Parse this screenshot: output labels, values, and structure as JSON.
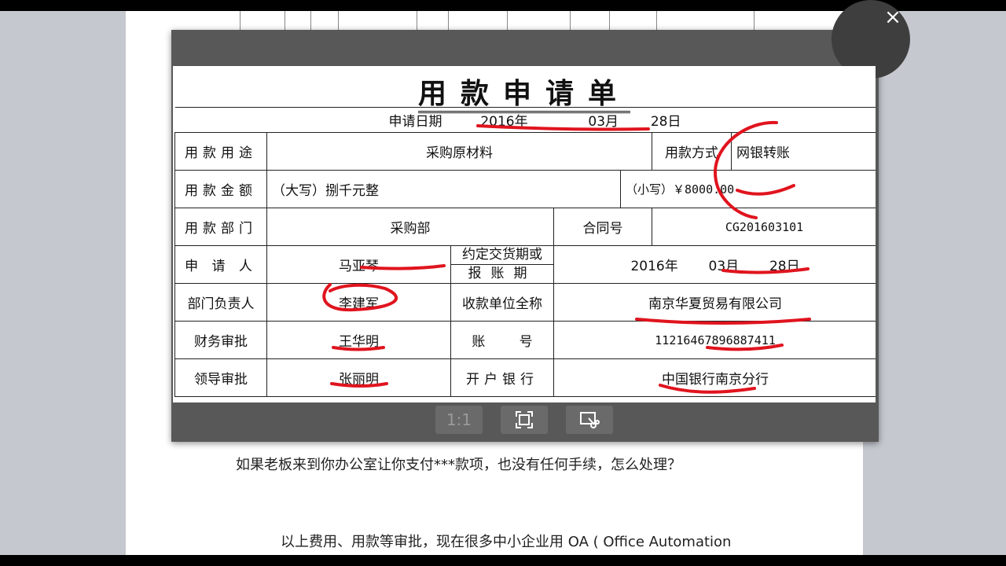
{
  "document": {
    "line1": "如果老板来到你办公室让你支付***款项，也没有任何手续，怎么处理？",
    "line2": "以上费用、用款等审批，现在很多中小企业用 OA ( Office Automation"
  },
  "viewer": {
    "close_label": "×",
    "close_icon": "close-icon",
    "toolbar": {
      "actual_size_label": "1:1",
      "fit_icon": "fit-screen-icon",
      "crop_icon": "screenshot-scissors-icon"
    }
  },
  "form": {
    "title": "用款申请单",
    "apply_date_label": "申请日期",
    "apply_date_year": "2016年",
    "apply_date_month": "03月",
    "apply_date_day": "28日",
    "purpose_label": "用款用途",
    "purpose_value": "采购原材料",
    "method_label": "用款方式",
    "method_value": "网银转账",
    "amount_label": "用款金额",
    "amount_upper": "（大写）捌千元整",
    "amount_lower": "（小写）￥8000.00",
    "dept_label": "用款部门",
    "dept_value": "采购部",
    "contract_label": "合同号",
    "contract_value": "CG201603101",
    "applicant_label": "申 请 人",
    "applicant_value": "马亚琴",
    "delivery_label_top": "约定交货期或",
    "delivery_label_bottom": "报账期",
    "delivery_year": "2016年",
    "delivery_month": "03月",
    "delivery_day": "28日",
    "dept_head_label": "部门负责人",
    "dept_head_value": "李建军",
    "payee_label": "收款单位全称",
    "payee_value": "南京华夏贸易有限公司",
    "finance_label": "财务审批",
    "finance_value": "王华明",
    "account_label": "账        号",
    "account_value": "11216467896887411",
    "leader_label": "领导审批",
    "leader_value": "张丽明",
    "bank_label": "开户银行",
    "bank_value": "中国银行南京分行"
  },
  "colors": {
    "annotation": "#e0141e",
    "viewer_bg": "#585858",
    "page_bg": "#c5c8cf"
  }
}
